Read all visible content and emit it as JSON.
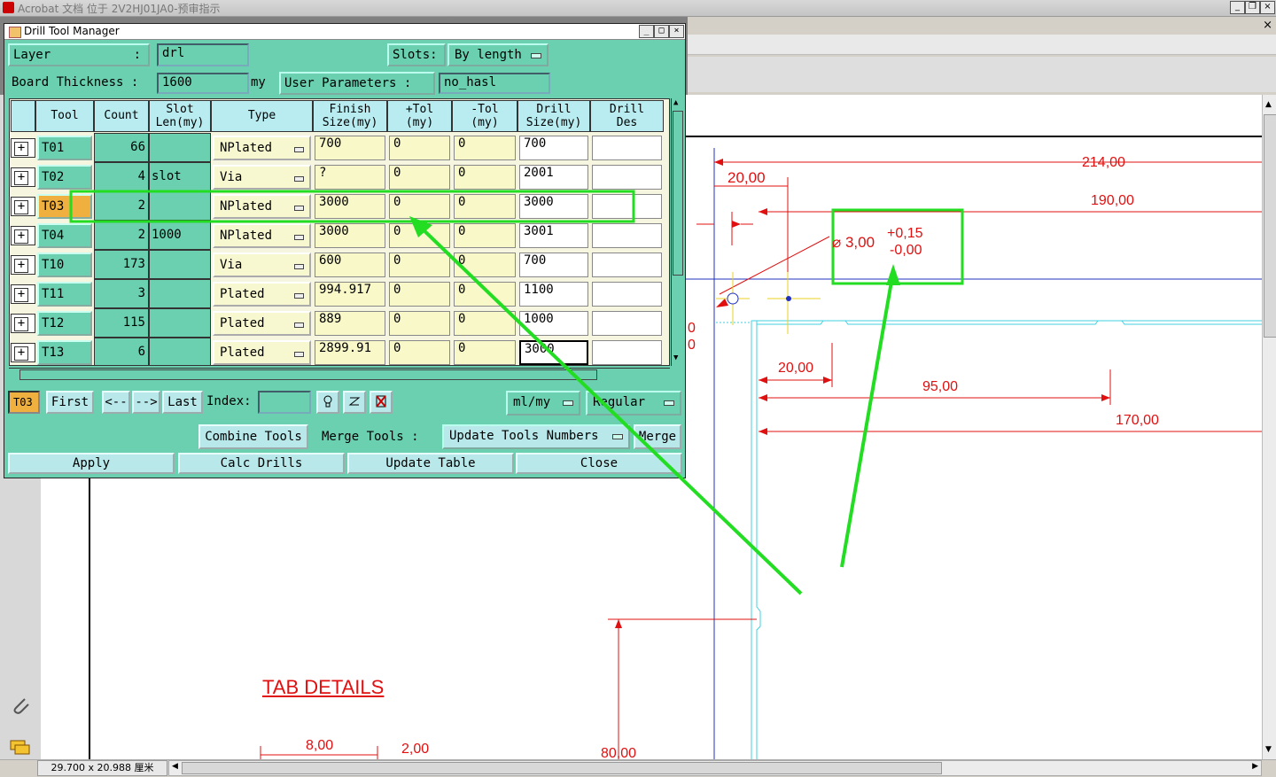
{
  "acrobat": {
    "title": "Acrobat 文档 位于 2V2HJ01JA0-预审指示",
    "doc_close_glyph": "×",
    "page_size": "29.700 x 20.988 厘米"
  },
  "dialog": {
    "title": "Drill Tool Manager",
    "layer_label": "Layer",
    "layer_colon": ":",
    "layer_value": "drl",
    "slots_label": "Slots:",
    "slots_value": "By length",
    "board_thickness_label": "Board Thickness :",
    "board_thickness_value": "1600",
    "board_thickness_unit": "my",
    "user_params_label": "User Parameters :",
    "user_params_value": "no_hasl",
    "columns": [
      "Tool",
      "Count",
      "Slot\nLen(my)",
      "Type",
      "Finish\nSize(my)",
      "+Tol\n(my)",
      "-Tol\n(my)",
      "Drill\nSize(my)",
      "Drill\nDes"
    ],
    "rows": [
      {
        "tool": "T01",
        "count": "66",
        "slot": "",
        "type": "NPlated",
        "finish": "700",
        "ptol": "0",
        "mtol": "0",
        "drill": "700",
        "des": ""
      },
      {
        "tool": "T02",
        "count": "4",
        "slot": "slot",
        "type": "Via",
        "finish": "?",
        "ptol": "0",
        "mtol": "0",
        "drill": "2001",
        "des": ""
      },
      {
        "tool": "T03",
        "count": "2",
        "slot": "",
        "type": "NPlated",
        "finish": "3000",
        "ptol": "0",
        "mtol": "0",
        "drill": "3000",
        "des": ""
      },
      {
        "tool": "T04",
        "count": "2",
        "slot": "1000",
        "type": "NPlated",
        "finish": "3000",
        "ptol": "0",
        "mtol": "0",
        "drill": "3001",
        "des": ""
      },
      {
        "tool": "T10",
        "count": "173",
        "slot": "",
        "type": "Via",
        "finish": "600",
        "ptol": "0",
        "mtol": "0",
        "drill": "700",
        "des": ""
      },
      {
        "tool": "T11",
        "count": "3",
        "slot": "",
        "type": "Plated",
        "finish": "994.917",
        "ptol": "0",
        "mtol": "0",
        "drill": "1100",
        "des": ""
      },
      {
        "tool": "T12",
        "count": "115",
        "slot": "",
        "type": "Plated",
        "finish": "889",
        "ptol": "0",
        "mtol": "0",
        "drill": "1000",
        "des": ""
      },
      {
        "tool": "T13",
        "count": "6",
        "slot": "",
        "type": "Plated",
        "finish": "2899.91",
        "ptol": "0",
        "mtol": "0",
        "drill": "3000",
        "des": ""
      }
    ],
    "selected_tool": "T03",
    "nav": {
      "first": "First",
      "prev": "<--",
      "next": "-->",
      "last": "Last",
      "index_label": "Index:",
      "index_value": ""
    },
    "units_value": "ml/my",
    "mode_value": "Regular",
    "combine_tools": "Combine Tools",
    "merge_tools_label": "Merge Tools :",
    "merge_tools_value": "Update Tools Numbers",
    "merge_button": "Merge",
    "apply": "Apply",
    "calc_drills": "Calc Drills",
    "update_table": "Update Table",
    "close": "Close"
  },
  "drawing": {
    "dims": [
      "214,00",
      "20,00",
      "190,00",
      "20,00",
      "95,00",
      "170,00",
      "8,00",
      "2,00",
      "80,00"
    ],
    "hole_callout_diameter": "⌀ 3,00",
    "hole_tol_plus": "+0,15",
    "hole_tol_minus": "-0,00",
    "tab_details": "TAB DETAILS",
    "partial_labels": [
      "0",
      "0"
    ]
  },
  "colors": {
    "dialog_bg": "#6ad0b0",
    "annotation": "#22dd22",
    "dimension_red": "#e01010",
    "board_cyan": "#40d0e0"
  }
}
